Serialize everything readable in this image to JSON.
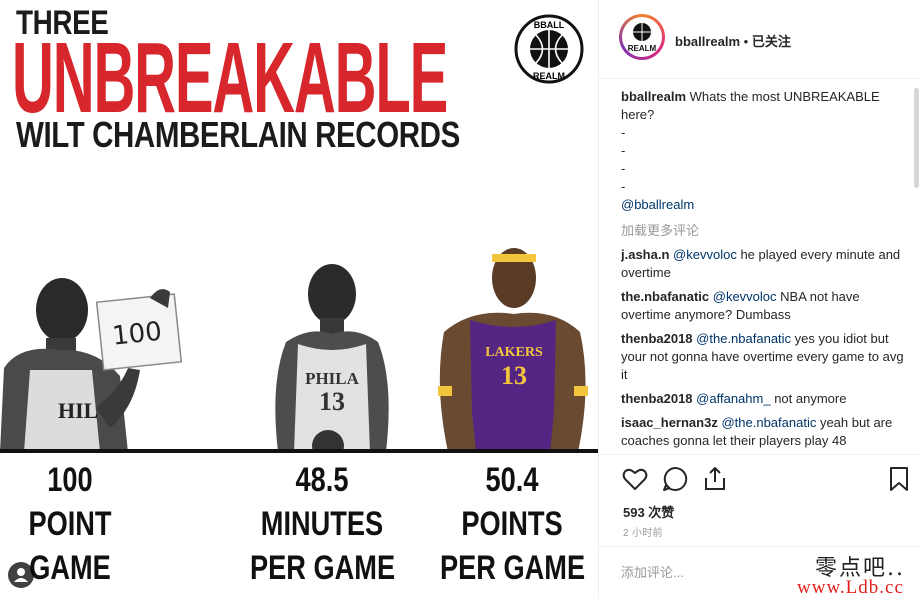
{
  "image": {
    "headline_small": "THREE",
    "headline_big": "UNBREAKABLE",
    "headline_sub": "WILT CHAMBERLAIN RECORDS",
    "logo_text_top": "BBALL",
    "logo_text_bottom": "REALM",
    "sign_text": "100",
    "jersey_1": "PHILA",
    "jersey_1_number": "13",
    "jersey_2": "LAKERS",
    "jersey_2_number": "13",
    "stats": [
      {
        "value": "100",
        "line2": "POINT",
        "line3": "GAME"
      },
      {
        "value": "48.5",
        "line2": "MINUTES",
        "line3": "PER GAME"
      },
      {
        "value": "50.4",
        "line2": "POINTS",
        "line3": "PER GAME"
      }
    ],
    "colors": {
      "accent_red": "#d8262d",
      "text_dark": "#1b1b1b",
      "lakers_gold": "#f2c53d",
      "lakers_purple": "#552583"
    }
  },
  "header": {
    "avatar_text": "REALM",
    "username": "bballrealm",
    "separator": " • ",
    "follow_status": "已关注"
  },
  "caption": {
    "username": "bballrealm",
    "text": "Whats the most UNBREAKABLE here?",
    "dashes": [
      "-",
      "-",
      "-",
      "-"
    ],
    "mention": "@bballrealm"
  },
  "load_more": "加载更多评论",
  "comments": [
    {
      "user": "j.asha.n",
      "mention": "@kevvoloc",
      "text": " he played every minute and overtime"
    },
    {
      "user": "the.nbafanatic",
      "mention": "@kevvoloc",
      "text": " NBA not have overtime anymore? Dumbass"
    },
    {
      "user": "thenba2018",
      "mention": "@the.nbafanatic",
      "text": " yes you idiot but your not gonna have overtime every game to avg it"
    },
    {
      "user": "thenba2018",
      "mention": "@affanahm_",
      "text": " not anymore"
    },
    {
      "user": "isaac_hernan3z",
      "mention": "@the.nbafanatic",
      "text": " yeah but are coaches gonna let their players play 48"
    }
  ],
  "actions": {
    "like_icon": "heart-icon",
    "comment_icon": "comment-bubble-icon",
    "share_icon": "share-icon",
    "save_icon": "bookmark-icon",
    "likes": "593 次赞",
    "time_ago": "2 小时前"
  },
  "comment_box": {
    "placeholder": "添加评论..."
  },
  "watermark": {
    "cn": "零点吧..",
    "url": "www.Ldb.cc"
  }
}
